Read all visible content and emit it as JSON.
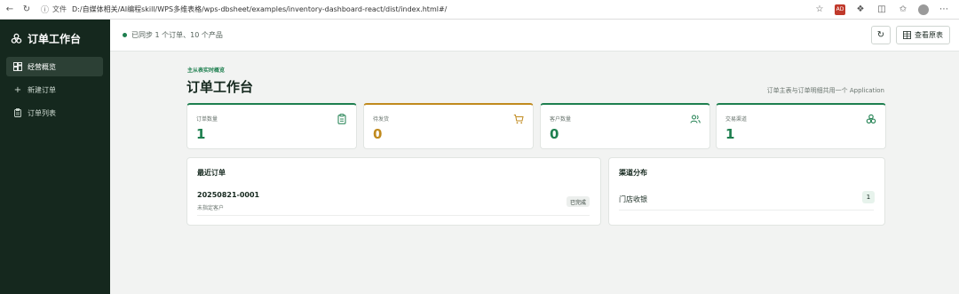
{
  "browser": {
    "back_icon": "arrow-left-icon",
    "reload_icon": "reload-icon",
    "address_label": "文件",
    "url": "D:/自媒体相关/AI编程skill/WPS多维表格/wps-dbsheet/examples/inventory-dashboard-react/dist/index.html#/",
    "ext_badge": "AD"
  },
  "sidebar": {
    "brand": "订单工作台",
    "items": [
      {
        "label": "经营概览",
        "icon": "dashboard-icon",
        "active": true
      },
      {
        "label": "新建订单",
        "icon": "plus-icon",
        "active": false
      },
      {
        "label": "订单列表",
        "icon": "clipboard-icon",
        "active": false
      }
    ]
  },
  "topbar": {
    "sync_status": "已同步 1 个订单、10 个产品",
    "view_sheet_label": "查看原表"
  },
  "header": {
    "eyebrow": "主从表实时概览",
    "title": "订单工作台",
    "subtitle": "订单主表与订单明细共用一个 Application"
  },
  "stats": [
    {
      "label": "订单数量",
      "value": "1",
      "icon": "clipboard-icon"
    },
    {
      "label": "待发货",
      "value": "0",
      "icon": "cart-icon"
    },
    {
      "label": "客户数量",
      "value": "0",
      "icon": "users-icon"
    },
    {
      "label": "交易渠道",
      "value": "1",
      "icon": "channel-icon"
    }
  ],
  "recent_orders": {
    "title": "最近订单",
    "rows": [
      {
        "id": "20250821-0001",
        "customer": "未指定客户",
        "status": "已完成"
      }
    ]
  },
  "channels": {
    "title": "渠道分布",
    "rows": [
      {
        "name": "门店收银",
        "count": "1"
      }
    ]
  },
  "colors": {
    "accent": "#1e7f4f",
    "warning": "#c08a1e",
    "sidebar_bg": "#15281e"
  }
}
